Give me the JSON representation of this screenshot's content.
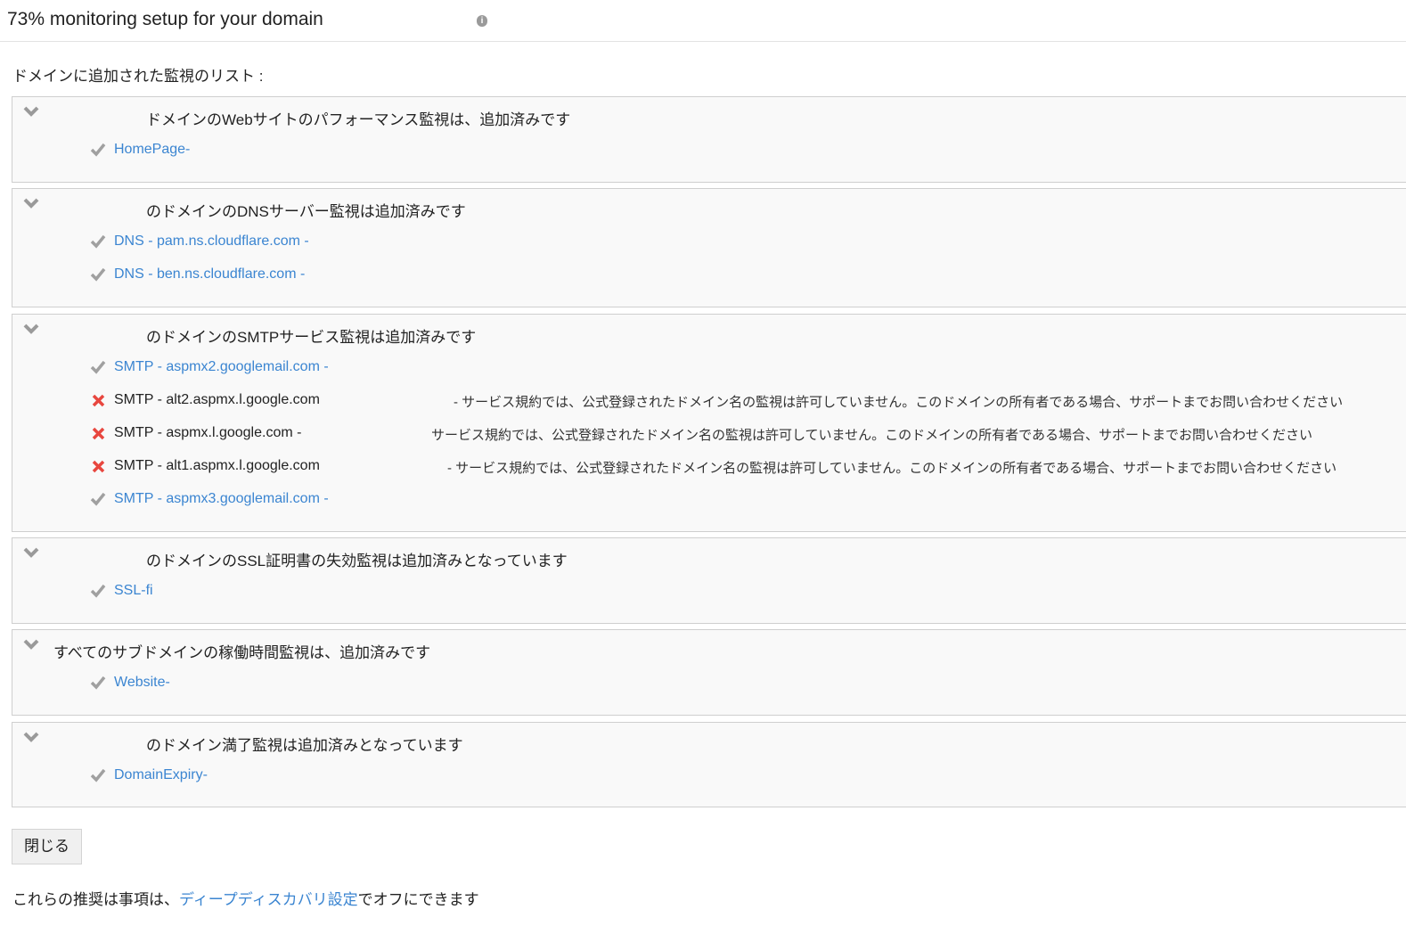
{
  "header": {
    "title": "73% monitoring setup for your domain",
    "info_icon": "i"
  },
  "subtitle": "ドメインに追加された監視のリスト :",
  "colors": {
    "link": "#3b85d1",
    "error": "#e8473f",
    "check": "#999999"
  },
  "sections": [
    {
      "title": "ドメインのWebサイトのパフォーマンス監視は、追加済みです",
      "items": [
        {
          "label": "HomePage-",
          "status": "ok"
        }
      ]
    },
    {
      "title": "のドメインのDNSサーバー監視は追加済みです",
      "items": [
        {
          "label": "DNS - pam.ns.cloudflare.com -",
          "status": "ok"
        },
        {
          "label": "DNS - ben.ns.cloudflare.com -",
          "status": "ok"
        }
      ]
    },
    {
      "title": "のドメインのSMTPサービス監視は追加済みです",
      "items": [
        {
          "label": "SMTP - aspmx2.googlemail.com -",
          "status": "ok"
        },
        {
          "label": "SMTP - alt2.aspmx.l.google.com",
          "status": "error",
          "message": "- サービス規約では、公式登録されたドメイン名の監視は許可していません。このドメインの所有者である場合、サポートまでお問い合わせください"
        },
        {
          "label": "SMTP - aspmx.l.google.com -",
          "status": "error",
          "message": "サービス規約では、公式登録されたドメイン名の監視は許可していません。このドメインの所有者である場合、サポートまでお問い合わせください"
        },
        {
          "label": "SMTP - alt1.aspmx.l.google.com",
          "status": "error",
          "message": "- サービス規約では、公式登録されたドメイン名の監視は許可していません。このドメインの所有者である場合、サポートまでお問い合わせください"
        },
        {
          "label": "SMTP - aspmx3.googlemail.com -",
          "status": "ok"
        }
      ]
    },
    {
      "title": "のドメインのSSL証明書の失効監視は追加済みとなっています",
      "items": [
        {
          "label": "SSL-fi",
          "status": "ok"
        }
      ]
    },
    {
      "title": "すべてのサブドメインの稼働時間監視は、追加済みです",
      "items": [
        {
          "label": "Website-",
          "status": "ok"
        }
      ]
    },
    {
      "title": "のドメイン満了監視は追加済みとなっています",
      "items": [
        {
          "label": "DomainExpiry-",
          "status": "ok"
        }
      ]
    }
  ],
  "close_button": "閉じる",
  "footer": {
    "prefix": "これらの推奨は事項は、",
    "link": "ディープディスカバリ設定",
    "suffix": "でオフにできます"
  }
}
